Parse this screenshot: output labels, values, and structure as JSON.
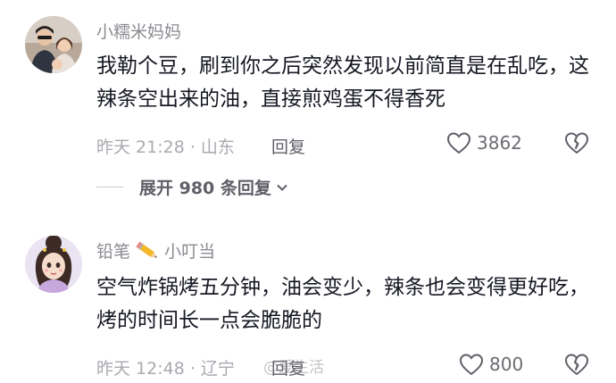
{
  "comments": [
    {
      "username": "小糯米妈妈",
      "text": "我勒个豆，刷到你之后突然发现以前简直是在乱吃，这辣条空出来的油，直接煎鸡蛋不得香死",
      "time_location": "昨天 21:28 · 山东",
      "reply_label": "回复",
      "likes": "3862",
      "expand_label": "展开 980 条回复"
    },
    {
      "username_prefix": "铅笔",
      "username_suffix": "小叮当",
      "text": "空气炸锅烤五分钟，油会变少，辣条也会变得更好吃，烤的时间长一点会脆脆的",
      "time_location": "昨天 12:48 · 辽宁",
      "reply_label": "回复",
      "likes": "800"
    }
  ],
  "watermark": "@爱生活",
  "icons": [
    "heart-outline-icon",
    "broken-heart-icon",
    "chevron-down-icon",
    "pencil-emoji-icon"
  ]
}
